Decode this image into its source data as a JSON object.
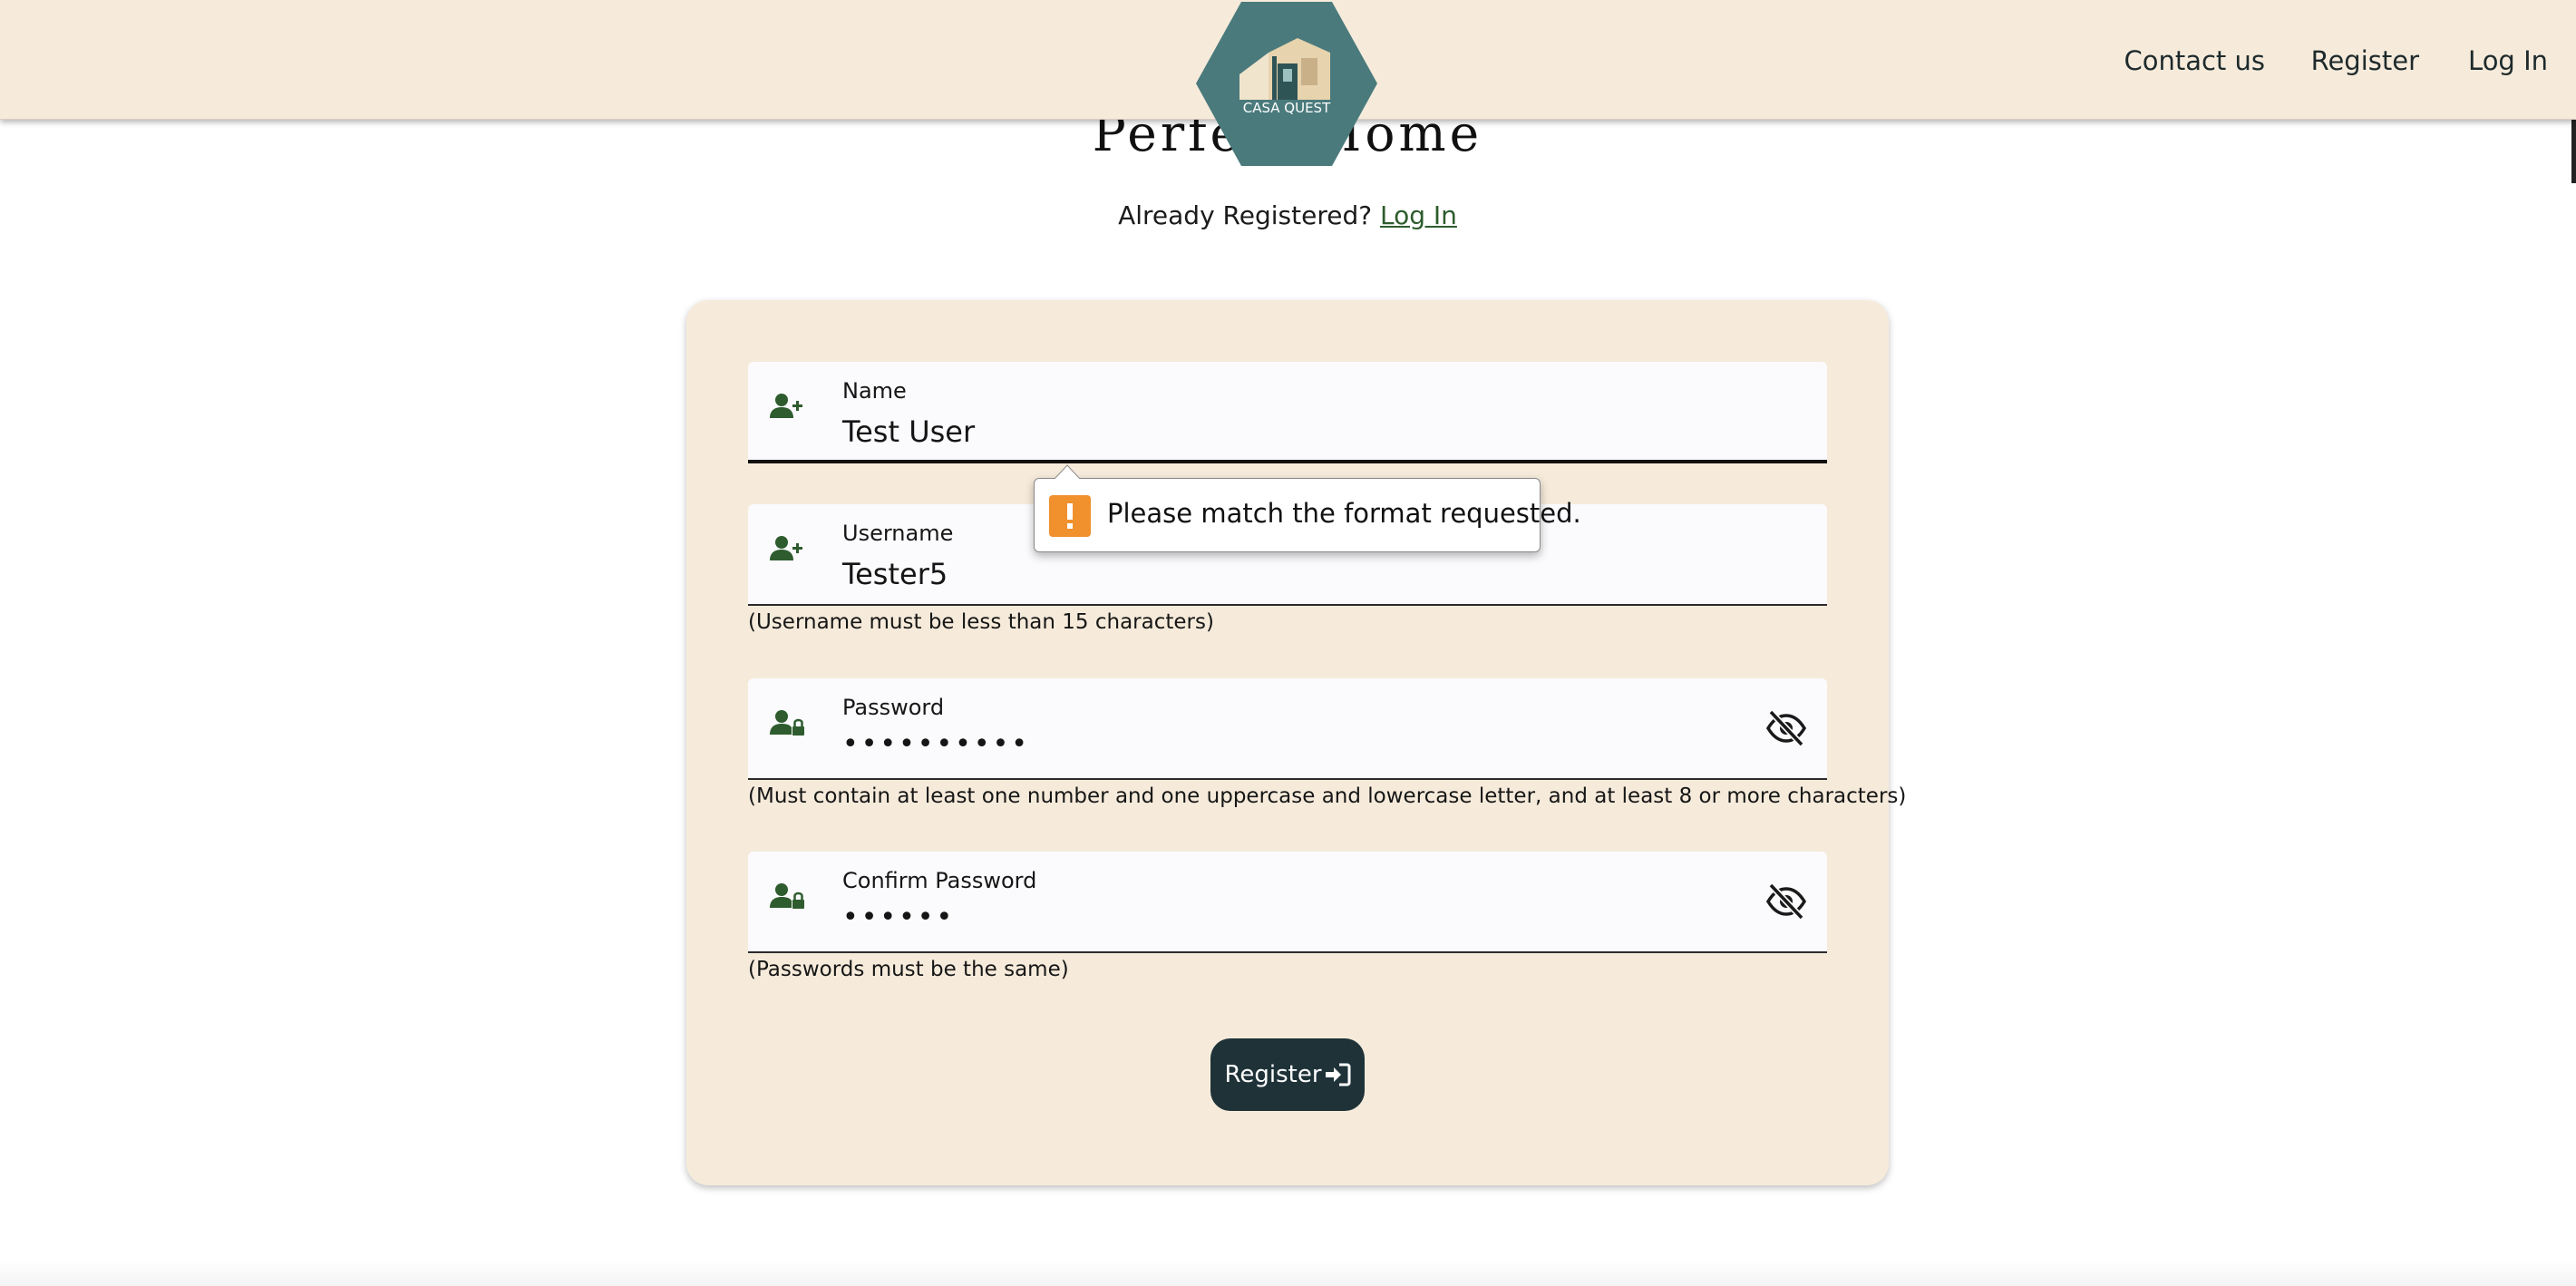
{
  "header": {
    "logo_text": "CASA QUEST",
    "nav": [
      {
        "label": "Contact us"
      },
      {
        "label": "Register"
      },
      {
        "label": "Log In"
      }
    ]
  },
  "page": {
    "title": "Perfect Home",
    "already_text": "Already Registered? ",
    "login_link": "Log In"
  },
  "form": {
    "name": {
      "label": "Name",
      "value": "Test User",
      "icon": "user-plus-icon"
    },
    "username": {
      "label": "Username",
      "value": "Tester5",
      "icon": "user-plus-icon",
      "helper": "(Username must be less than 15 characters)"
    },
    "password": {
      "label": "Password",
      "value": "••••••••••",
      "icon": "user-lock-icon",
      "toggle_icon": "eye-slash-icon",
      "helper": "(Must contain at least one number and one uppercase and lowercase letter, and at least 8 or more characters)"
    },
    "confirm_password": {
      "label": "Confirm Password",
      "value": "••••••",
      "icon": "user-lock-icon",
      "toggle_icon": "eye-slash-icon",
      "helper": "(Passwords must be the same)"
    },
    "submit_label": "Register",
    "submit_icon": "sign-in-icon"
  },
  "validation": {
    "message": "Please match the format requested.",
    "icon": "warning-icon"
  },
  "colors": {
    "header_bg": "#f6ebdb",
    "card_bg": "#f6ebdb",
    "logo_bg": "#4a7a7c",
    "icon_green": "#2e5c2e",
    "button_bg": "#1e3238",
    "warning": "#f0912e"
  }
}
